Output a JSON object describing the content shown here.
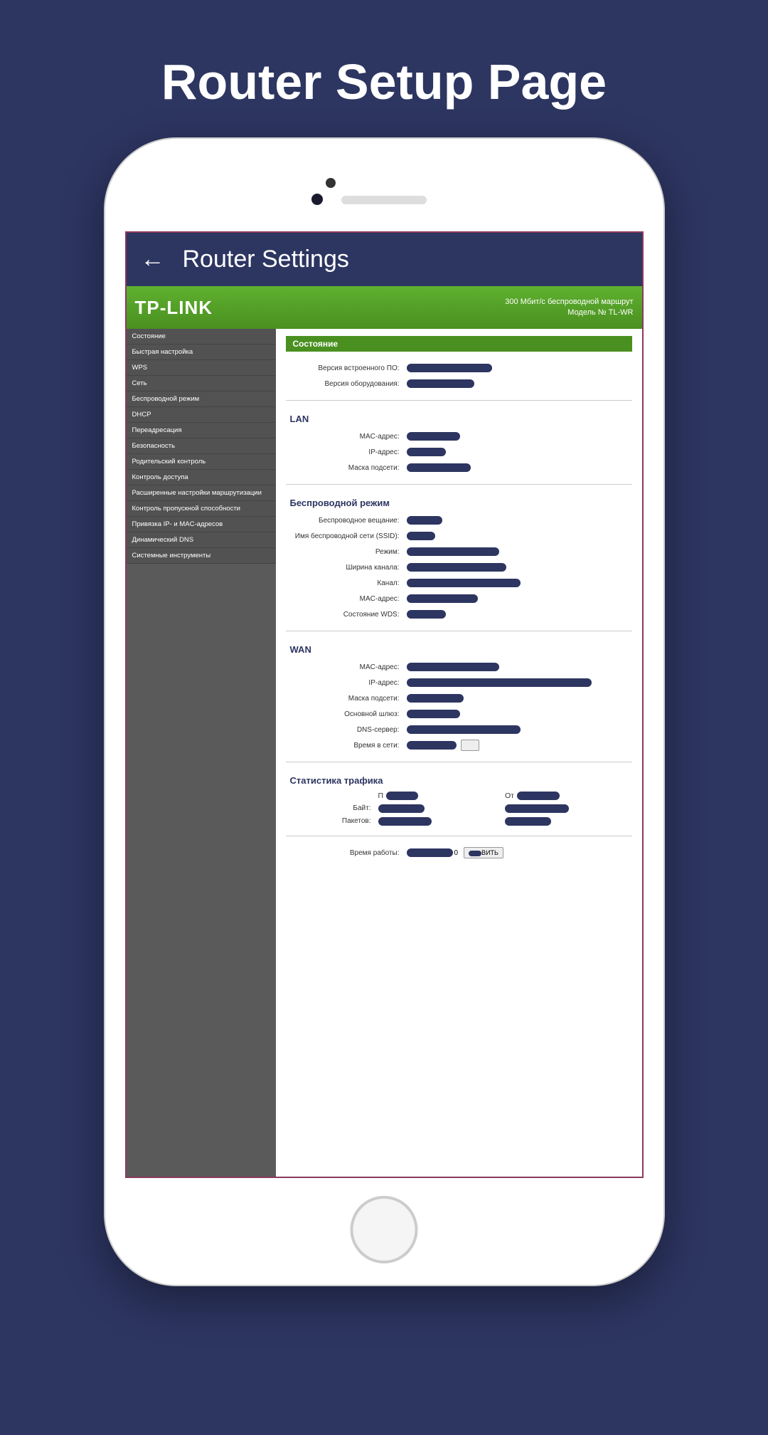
{
  "page_title": "Router Setup Page",
  "app_header": {
    "title": "Router Settings"
  },
  "banner": {
    "brand": "TP-LINK",
    "subtitle_top": "300 Мбит/с беспроводной маршрут",
    "subtitle_bottom": "Модель № TL-WR"
  },
  "sidebar": {
    "items": [
      "Состояние",
      "Быстрая настройка",
      "WPS",
      "Сеть",
      "Беспроводной режим",
      "DHCP",
      "Переадресация",
      "Безопасность",
      "Родительский контроль",
      "Контроль доступа",
      "Расширенные настройки маршрутизации",
      "Контроль пропускной способности",
      "Привязка IP- и MAC-адресов",
      "Динамический DNS",
      "Системные инструменты"
    ]
  },
  "status": {
    "header": "Состояние",
    "top_labels": {
      "firmware": "Версия встроенного ПО:",
      "hardware": "Версия оборудования:"
    },
    "lan": {
      "title": "LAN",
      "mac": "MAC-адрес:",
      "ip": "IP-адрес:",
      "mask": "Маска подсети:"
    },
    "wireless": {
      "title": "Беспроводной режим",
      "broadcast": "Беспроводное вещание:",
      "ssid": "Имя беспроводной сети (SSID):",
      "mode": "Режим:",
      "channel_width": "Ширина канала:",
      "channel": "Канал:",
      "mac": "MAC-адрес:",
      "wds": "Состояние WDS:"
    },
    "wan": {
      "title": "WAN",
      "mac": "MAC-адрес:",
      "ip": "IP-адрес:",
      "mask": "Маска подсети:",
      "gateway": "Основной шлюз:",
      "dns": "DNS-сервер:",
      "uptime": "Время в сети:"
    },
    "traffic": {
      "title": "Статистика трафика",
      "col_rx_prefix": "П",
      "col_tx_prefix": "От",
      "bytes": "Байт:",
      "packets": "Пакетов:"
    },
    "footer": {
      "runtime": "Время работы:",
      "refresh_suffix": "ВИТЬ",
      "seconds_suffix": "0"
    }
  }
}
